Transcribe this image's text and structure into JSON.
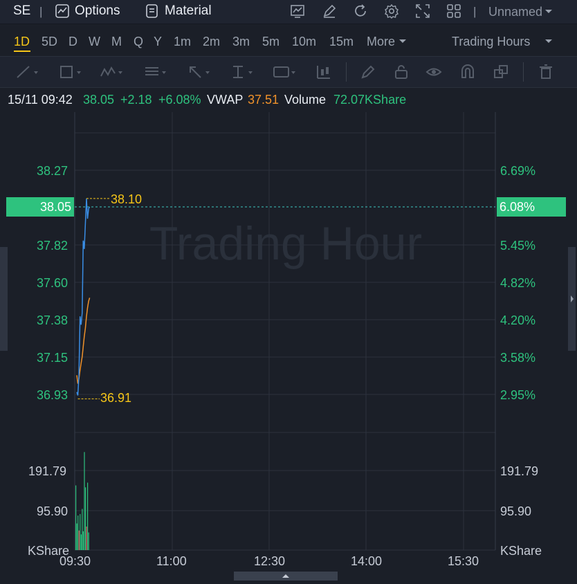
{
  "topbar": {
    "symbol": "SE",
    "sep": "|",
    "options_label": "Options",
    "material_label": "Material",
    "layout_label": "Unnamed",
    "icons": [
      "options-icon",
      "material-icon",
      "indicator-icon",
      "draw-pen-icon",
      "refresh-icon",
      "settings-icon",
      "fullscreen-icon",
      "grid-layout-icon",
      "dropdown-caret-icon"
    ]
  },
  "timeframes": {
    "items": [
      "1D",
      "5D",
      "D",
      "W",
      "M",
      "Q",
      "Y",
      "1m",
      "2m",
      "3m",
      "5m",
      "10m",
      "15m",
      "More"
    ],
    "active": "1D",
    "session_label": "Trading Hours"
  },
  "drawing_tools": [
    "trend-line-icon",
    "rectangle-icon",
    "pattern-icon",
    "fibonacci-icon",
    "arrow-icon",
    "text-cursor-icon",
    "annotation-icon",
    "candlestick-icon",
    "pencil-icon",
    "lock-icon",
    "eye-icon",
    "magnet-icon",
    "clone-icon",
    "trash-icon"
  ],
  "info": {
    "datetime": "15/11 09:42",
    "price": "38.05",
    "change": "+2.18",
    "change_pct": "+6.08%",
    "vwap_label": "VWAP",
    "vwap_value": "37.51",
    "volume_label": "Volume",
    "volume_value": "72.07KShare"
  },
  "chart": {
    "watermark": "Trading Hour",
    "price_ticks": [
      "38.27",
      "37.82",
      "37.60",
      "37.38",
      "37.15",
      "36.93"
    ],
    "pct_ticks": [
      "6.69%",
      "5.45%",
      "4.82%",
      "4.20%",
      "3.58%",
      "2.95%"
    ],
    "current_price": "38.05",
    "current_pct": "6.08%",
    "high_label": "38.10",
    "low_label": "36.91",
    "volume_ticks": [
      "191.79",
      "95.90"
    ],
    "volume_unit": "KShare",
    "time_ticks": [
      "09:30",
      "11:00",
      "12:30",
      "14:00",
      "15:30"
    ],
    "colors": {
      "up": "#2ec27e",
      "down": "#e8505b",
      "price_line": "#3a8ee6",
      "vwap_line": "#f0922b",
      "highlight": "#f5c518"
    }
  },
  "chart_data": {
    "type": "line",
    "x_range": [
      "09:30",
      "16:00"
    ],
    "y_range": [
      36.71,
      38.49
    ],
    "series": [
      {
        "name": "Price",
        "color": "#3a8ee6",
        "x": [
          "09:30",
          "09:31",
          "09:32",
          "09:33",
          "09:34",
          "09:35",
          "09:36",
          "09:37",
          "09:38",
          "09:39",
          "09:40",
          "09:41",
          "09:42"
        ],
        "values": [
          36.95,
          36.93,
          37.05,
          37.4,
          37.35,
          37.42,
          37.85,
          37.8,
          37.95,
          38.1,
          37.98,
          38.04,
          38.05
        ]
      },
      {
        "name": "VWAP",
        "color": "#f0922b",
        "x": [
          "09:30",
          "09:31",
          "09:32",
          "09:33",
          "09:34",
          "09:35",
          "09:36",
          "09:37",
          "09:38",
          "09:39",
          "09:40",
          "09:41",
          "09:42"
        ],
        "values": [
          37.05,
          37.0,
          37.03,
          37.08,
          37.12,
          37.16,
          37.22,
          37.28,
          37.33,
          37.4,
          37.45,
          37.49,
          37.51
        ]
      }
    ],
    "volume": {
      "unit": "KShare",
      "x": [
        "09:30",
        "09:31",
        "09:32",
        "09:33",
        "09:34",
        "09:35",
        "09:36",
        "09:37",
        "09:38",
        "09:39",
        "09:40",
        "09:41",
        "09:42"
      ],
      "values": [
        165,
        68,
        88,
        50,
        92,
        40,
        105,
        48,
        250,
        160,
        60,
        172,
        45
      ],
      "up": [
        true,
        true,
        true,
        false,
        true,
        true,
        true,
        true,
        true,
        true,
        false,
        true,
        true
      ]
    },
    "high": 38.1,
    "low": 36.91
  }
}
